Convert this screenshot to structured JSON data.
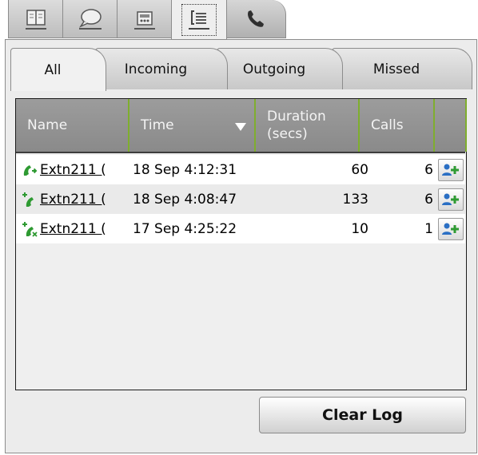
{
  "top_tabs": [
    {
      "icon": "address-book-icon"
    },
    {
      "icon": "chat-bubble-icon"
    },
    {
      "icon": "voicemail-icon"
    },
    {
      "icon": "call-log-icon",
      "active": true
    },
    {
      "icon": "phone-icon"
    }
  ],
  "sub_tabs": [
    {
      "label": "All",
      "active": true
    },
    {
      "label": "Incoming"
    },
    {
      "label": "Outgoing"
    },
    {
      "label": "Missed"
    }
  ],
  "table": {
    "columns": {
      "name": "Name",
      "time": "Time",
      "duration_line1": "Duration",
      "duration_line2": "(secs)",
      "calls": "Calls"
    },
    "rows": [
      {
        "type": "incoming",
        "icon": "incoming-call-icon",
        "name": "Extn211 (",
        "time": "18 Sep 4:12:31",
        "duration": "60",
        "calls": "6"
      },
      {
        "type": "outgoing",
        "icon": "outgoing-call-icon",
        "name": "Extn211 (",
        "time": "18 Sep 4:08:47",
        "duration": "133",
        "calls": "6"
      },
      {
        "type": "missed",
        "icon": "missed-call-icon",
        "name": "Extn211 (",
        "time": "17 Sep 4:25:22",
        "duration": "10",
        "calls": "1"
      }
    ]
  },
  "clear_log_label": "Clear Log",
  "colors": {
    "header_bg": "#9a9a9a",
    "header_divider": "#7fae2e",
    "call_icon_green": "#2e9a32",
    "add_contact_blue": "#2a6fc4"
  }
}
